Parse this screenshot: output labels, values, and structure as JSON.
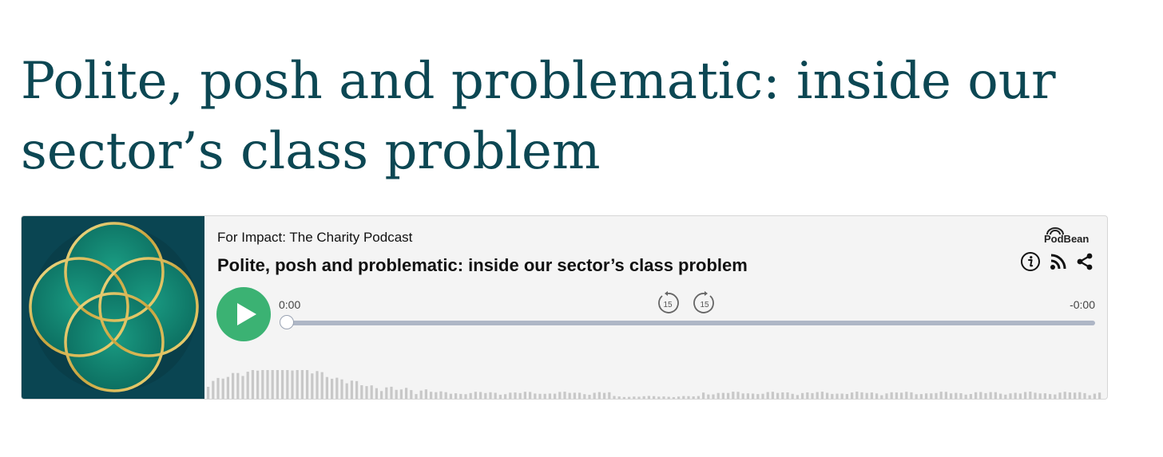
{
  "article": {
    "title": "Polite, posh and problematic: inside our sector’s class problem"
  },
  "player": {
    "brand": "PodBean",
    "podcast_name": "For Impact: The Charity Podcast",
    "episode_title": "Polite, posh and problematic: inside our sector’s class problem",
    "current_time": "0:00",
    "remaining_time": "-0:00",
    "progress": 0,
    "skip_back_seconds": "15",
    "skip_forward_seconds": "15",
    "icons": [
      "info-icon",
      "rss-icon",
      "share-icon",
      "play-icon",
      "rewind-15-icon",
      "forward-15-icon"
    ],
    "colors": {
      "title": "#0c4753",
      "play_button": "#3bb273",
      "artwork_bg": "#0a4552",
      "track": "#aeb6c6",
      "waveform": "#c8c8c8"
    }
  }
}
